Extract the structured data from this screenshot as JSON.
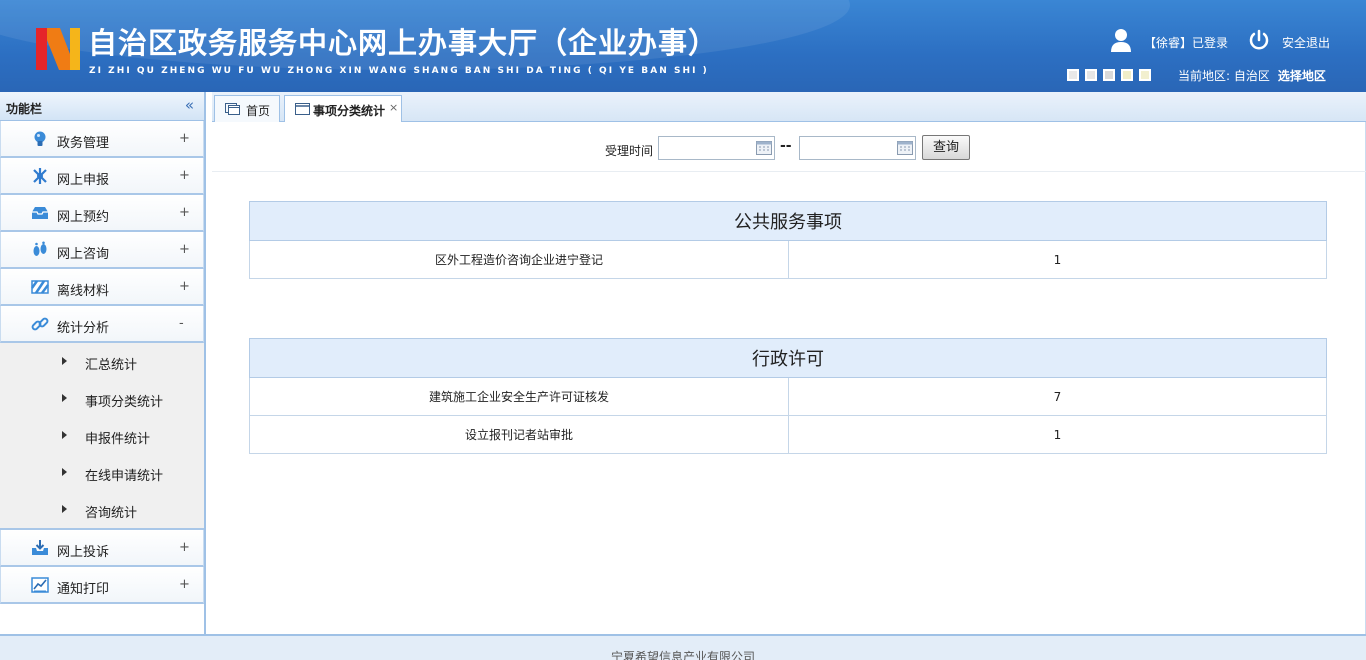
{
  "header": {
    "title": "自治区政务服务中心网上办事大厅（企业办事）",
    "pinyin": "ZI ZHI QU ZHENG WU FU WU ZHONG XIN WANG SHANG BAN SHI DA TING ( QI YE BAN SHI )",
    "login_text": "【徐睿】已登录",
    "logout_label": "安全退出",
    "skin_colors": [
      "#e8e8e8",
      "#e6e6e6",
      "#d9d9d9",
      "#f0edc8",
      "#f2efcf"
    ],
    "region_label": "当前地区: 自治区",
    "choose_region": "选择地区"
  },
  "sidebar": {
    "title": "功能栏",
    "collapse": "«",
    "menus": [
      {
        "label": "政务管理",
        "sign": "+",
        "icon": "bulb-icon"
      },
      {
        "label": "网上申报",
        "sign": "+",
        "icon": "network-icon"
      },
      {
        "label": "网上预约",
        "sign": "+",
        "icon": "tray-icon"
      },
      {
        "label": "网上咨询",
        "sign": "+",
        "icon": "footprint-icon"
      },
      {
        "label": "离线材料",
        "sign": "+",
        "icon": "barrier-icon"
      },
      {
        "label": "统计分析",
        "sign": "-",
        "icon": "link-icon"
      }
    ],
    "submenu": [
      "汇总统计",
      "事项分类统计",
      "申报件统计",
      "在线申请统计",
      "咨询统计"
    ],
    "menus_after": [
      {
        "label": "网上投诉",
        "sign": "+",
        "icon": "download-tray-icon"
      },
      {
        "label": "通知打印",
        "sign": "+",
        "icon": "chart-icon"
      }
    ]
  },
  "tabs": [
    {
      "label": "首页"
    },
    {
      "label": "事项分类统计",
      "close": "×"
    }
  ],
  "query": {
    "label": "受理时间",
    "start_value": "",
    "end_value": "",
    "separator": "--",
    "button": "查询"
  },
  "sections": [
    {
      "title": "公共服务事项",
      "rows": [
        {
          "name": "区外工程造价咨询企业进宁登记",
          "count": "1"
        }
      ]
    },
    {
      "title": "行政许可",
      "rows": [
        {
          "name": "建筑施工企业安全生产许可证核发",
          "count": "7"
        },
        {
          "name": "设立报刊记者站审批",
          "count": "1"
        }
      ]
    }
  ],
  "footer": {
    "text": "宁夏希望信息产业有限公司"
  }
}
